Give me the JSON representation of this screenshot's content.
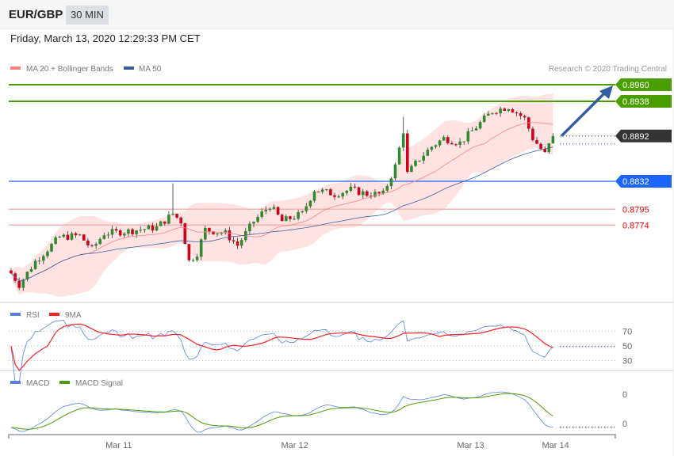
{
  "header": {
    "pair": "EUR/GBP",
    "timeframe": "30 MIN"
  },
  "date": "Friday, March 13, 2020 12:29:33 PM CET",
  "copyright": "Research © 2020 Trading Central",
  "legend": {
    "ma20": "MA 20 + Bollinger Bands",
    "ma50": "MA 50",
    "rsi": "RSI",
    "rsi_ma": "9MA",
    "macd": "MACD",
    "macd_signal": "MACD Signal"
  },
  "colors": {
    "up": "#2e8b2e",
    "down": "#d0021b",
    "resistance": "#4a9e00",
    "pivot": "#1a66ff",
    "support": "#ff0000",
    "current": "#333333",
    "ma20": "#ff8080",
    "ma50": "#3a5fa0",
    "rsi": "#5b7fe8",
    "rsi_ma": "#ff2020",
    "macd": "#5b7fe8",
    "signal": "#4a9e00",
    "arrow": "#2f5fa0"
  },
  "chart_data": {
    "type": "candlestick",
    "candle_count": 135,
    "close_keypoints": [
      [
        0,
        0.871
      ],
      [
        2,
        0.8695
      ],
      [
        6,
        0.8726
      ],
      [
        12,
        0.8758
      ],
      [
        17,
        0.876
      ],
      [
        20,
        0.8742
      ],
      [
        23,
        0.8763
      ],
      [
        29,
        0.8766
      ],
      [
        36,
        0.8771
      ],
      [
        40,
        0.8789
      ],
      [
        42,
        0.8779
      ],
      [
        44,
        0.8726
      ],
      [
        46,
        0.8737
      ],
      [
        48,
        0.8768
      ],
      [
        53,
        0.8763
      ],
      [
        56,
        0.8747
      ],
      [
        60,
        0.8779
      ],
      [
        64,
        0.88
      ],
      [
        67,
        0.8779
      ],
      [
        72,
        0.8789
      ],
      [
        75,
        0.8821
      ],
      [
        80,
        0.8815
      ],
      [
        84,
        0.8821
      ],
      [
        88,
        0.8815
      ],
      [
        92,
        0.8815
      ],
      [
        95,
        0.8852
      ],
      [
        97,
        0.8899
      ],
      [
        98,
        0.8842
      ],
      [
        101,
        0.8862
      ],
      [
        104,
        0.8878
      ],
      [
        107,
        0.8889
      ],
      [
        111,
        0.8883
      ],
      [
        115,
        0.8904
      ],
      [
        119,
        0.8925
      ],
      [
        123,
        0.8931
      ],
      [
        127,
        0.8915
      ],
      [
        129,
        0.8889
      ],
      [
        132,
        0.8868
      ],
      [
        134,
        0.8892
      ]
    ],
    "levels": [
      {
        "value": "0.8960",
        "type": "resistance"
      },
      {
        "value": "0.8938",
        "type": "resistance"
      },
      {
        "value": "0.8892",
        "type": "current"
      },
      {
        "value": "0.8832",
        "type": "pivot"
      },
      {
        "value": "0.8795",
        "type": "support"
      },
      {
        "value": "0.8774",
        "type": "support"
      }
    ],
    "x_labels": [
      {
        "label": "Mar 11",
        "index": 28
      },
      {
        "label": "Mar 12",
        "index": 71.5
      },
      {
        "label": "Mar 13",
        "index": 115
      },
      {
        "label": "Mar 14",
        "index": 136
      }
    ],
    "rsi_ticks": [
      "70",
      "50",
      "30"
    ],
    "macd_ticks": [
      "0",
      "0"
    ],
    "target_arrow": {
      "from": 0.8892,
      "to": 0.896
    }
  }
}
